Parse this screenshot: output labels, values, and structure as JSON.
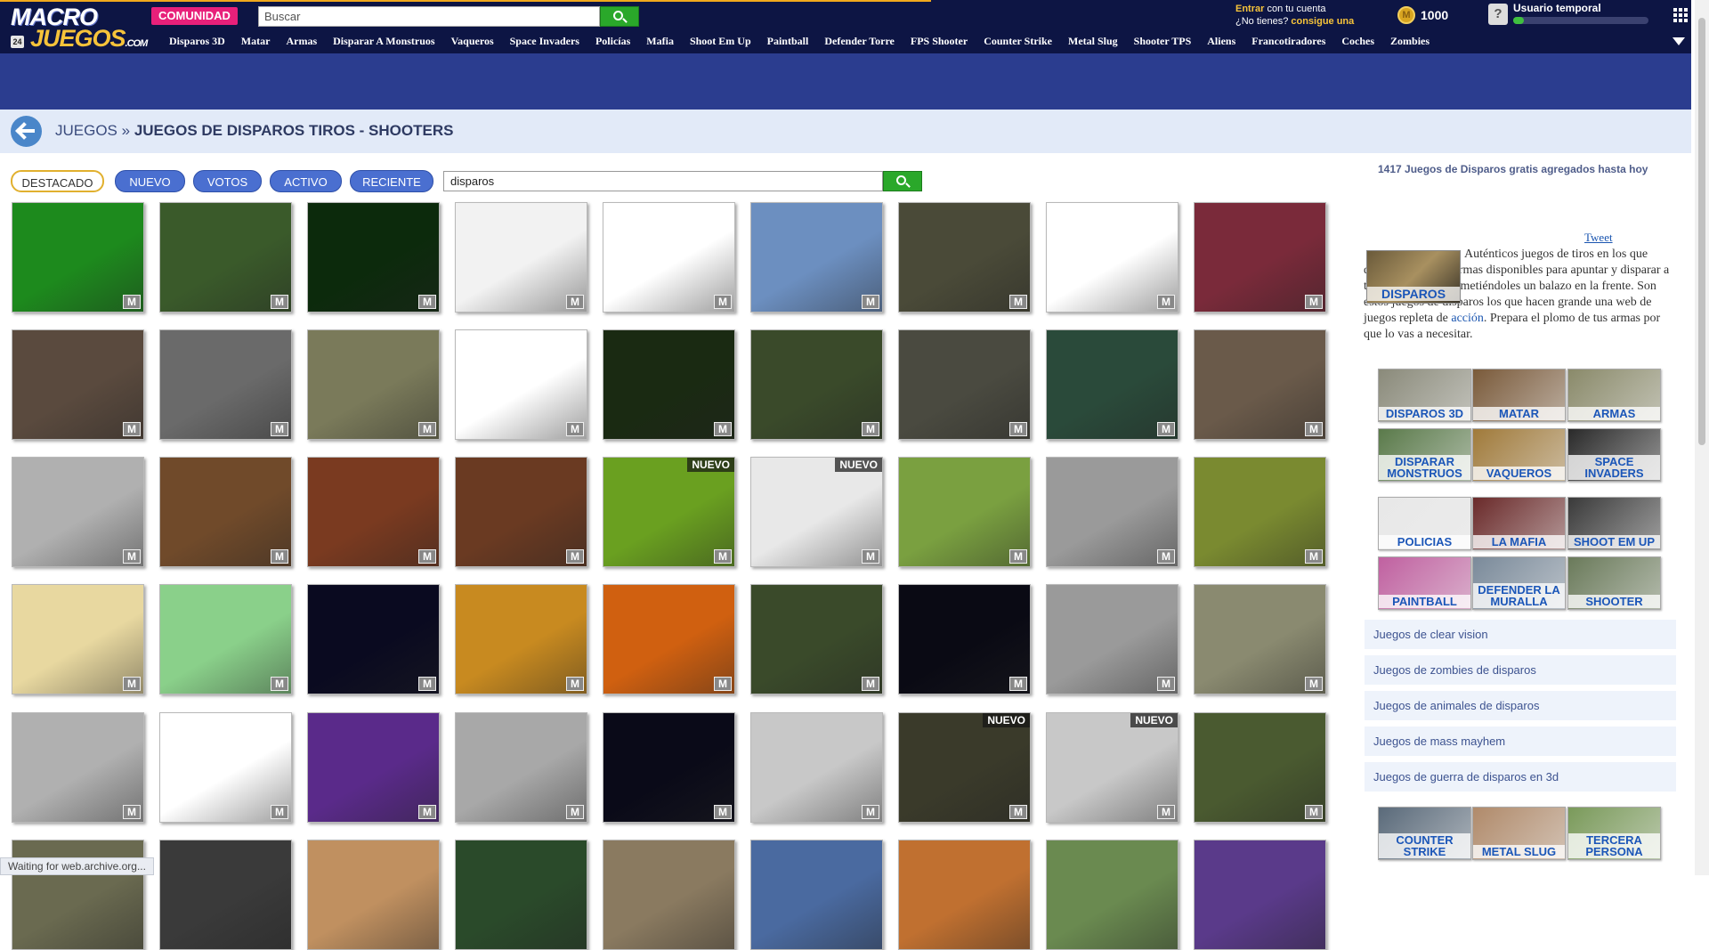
{
  "header": {
    "logo_top": "MACRO",
    "logo_bottom": "JUEGOS",
    "logo_suffix": ".COM",
    "community": "COMUNIDAD",
    "search_placeholder": "Buscar",
    "login_prefix": "Entrar",
    "login_rest": " con tu cuenta",
    "no_account": "¿No tienes? ",
    "register": "consigue una",
    "coins": "1000",
    "coin_symbol": "M",
    "user": "Usuario temporal",
    "xp_fraction": 0.08,
    "day_badge": "24"
  },
  "nav": [
    "Disparos 3D",
    "Matar",
    "Armas",
    "Disparar A Monstruos",
    "Vaqueros",
    "Space Invaders",
    "Policías",
    "Mafia",
    "Shoot Em Up",
    "Paintball",
    "Defender Torre",
    "FPS Shooter",
    "Counter Strike",
    "Metal Slug",
    "Shooter TPS",
    "Aliens",
    "Francotiradores",
    "Coches",
    "Zombies"
  ],
  "breadcrumb": {
    "root": "JUEGOS",
    "sep": " » ",
    "current": "JUEGOS DE DISPAROS TIROS - SHOOTERS"
  },
  "filters": {
    "tabs": [
      "DESTACADO",
      "NUEVO",
      "VOTOS",
      "ACTIVO",
      "RECIENTE"
    ],
    "active": "DESTACADO",
    "search_value": "disparos"
  },
  "grid": {
    "badge": "M",
    "new_label": "NUEVO",
    "new_items": [
      22,
      23,
      42,
      43,
      57
    ],
    "colors": [
      [
        "#1d8a1d",
        "#3a5a2a",
        "#0c2a0c",
        "#f2f2f2",
        "#ffffff",
        "#6c8fc0",
        "#4a4a38",
        "#ffffff",
        "#7a2a3a"
      ],
      [
        "#5a4a3e",
        "#6a6a6a",
        "#7a7a5a",
        "#ffffff",
        "#1a2a12",
        "#3a4a2a",
        "#4a4a40",
        "#2a4a3a",
        "#6a5a4a"
      ],
      [
        "#b0b0b0",
        "#704a2a",
        "#7a3a20",
        "#6a3a22",
        "#6aa020",
        "#e8e8e8",
        "#7aa040",
        "#9a9a9a",
        "#7a8a30"
      ],
      [
        "#e8d8a0",
        "#8ad08a",
        "#0a0a20",
        "#c88a20",
        "#d06010",
        "#3a4a2a",
        "#0a0a14",
        "#9a9a9a",
        "#8a8a70"
      ],
      [
        "#b0b0b0",
        "#ffffff",
        "#5a2a8a",
        "#a8a8a8",
        "#0a0a18",
        "#c8c8c8",
        "#3a3a2a",
        "#c8c8c8",
        "#4a5a30"
      ],
      [
        "#6a6a50",
        "#3a3a3a",
        "#c09060",
        "#2a4a2a",
        "#8a7a60",
        "#4a6aa0",
        "#c07030",
        "#6a8a50",
        "#5a3a8a"
      ]
    ]
  },
  "sidebar": {
    "title": "1417 Juegos de Disparos gratis agregados hasta hoy",
    "tweet": "Tweet",
    "feature_label": "DISPAROS",
    "desc_a": "Auténticos juegos de tiros en los que deberás coger tus armas disponibles para apuntar y disparar a todos tus objetivos metiéndoles un balazo en la frente. Son estos juegos de disparos los que hacen grande una web de juegos repleta de ",
    "desc_link": "acción",
    "desc_b": ". Prepara el plomo de tus armas por que lo vas a necesitar.",
    "categories": [
      "DISPAROS 3D",
      "MATAR",
      "ARMAS",
      "DISPARAR MONSTRUOS",
      "VAQUEROS",
      "SPACE INVADERS",
      "POLICIAS",
      "LA MAFIA",
      "SHOOT EM UP",
      "PAINTBALL",
      "DEFENDER LA MURALLA",
      "SHOOTER"
    ],
    "related": [
      "Juegos de clear vision",
      "Juegos de zombies de disparos",
      "Juegos de animales de disparos",
      "Juegos de mass mayhem",
      "Juegos de guerra de disparos en 3d"
    ],
    "categories2": [
      "COUNTER STRIKE",
      "METAL SLUG",
      "TERCERA PERSONA"
    ]
  },
  "status": "Waiting for web.archive.org..."
}
